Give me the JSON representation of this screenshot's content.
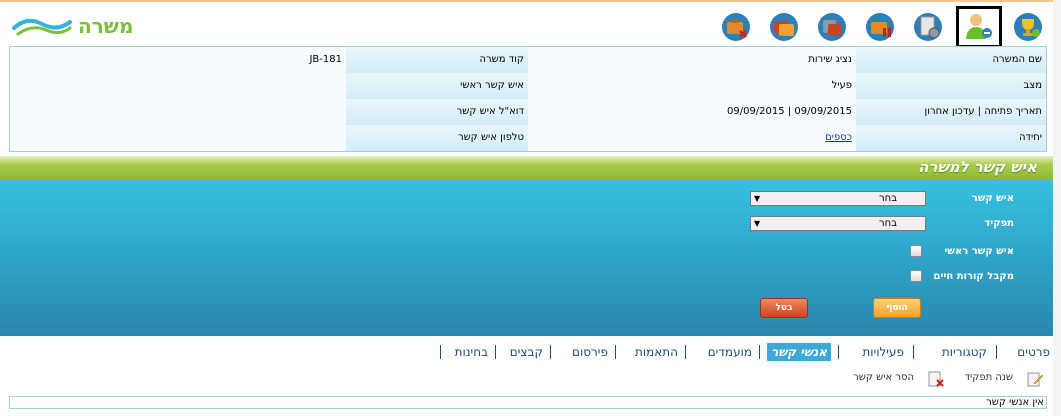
{
  "logo": {
    "text": "משרה"
  },
  "toolbar": {
    "icons": [
      {
        "name": "trophy-icon",
        "selected": false
      },
      {
        "name": "contact-person-icon",
        "selected": true
      },
      {
        "name": "document-settings-icon",
        "selected": false
      },
      {
        "name": "briefcase-pause-icon",
        "selected": false
      },
      {
        "name": "briefcase-copy-icon",
        "selected": false
      },
      {
        "name": "briefcase-stack-icon",
        "selected": false
      },
      {
        "name": "briefcase-delete-icon",
        "selected": false
      }
    ]
  },
  "info": {
    "rows": [
      {
        "label1": "שם המשרה",
        "value1": "נציג שירות",
        "label2": "קוד משרה",
        "value2": "JB-181"
      },
      {
        "label1": "מצב",
        "value1": "פעיל",
        "label2": "איש קשר ראשי",
        "value2": ""
      },
      {
        "label1": "תאריך פתיחה | עדכון אחרון",
        "value1": "09/09/2015 | 09/09/2015",
        "label2": "דוא\"ל איש קשר",
        "value2": ""
      },
      {
        "label1": "יחידה",
        "value1": "כספים",
        "label2": "טלפון איש קשר",
        "value2": ""
      }
    ]
  },
  "section": {
    "title": "איש קשר למשרה"
  },
  "form": {
    "contact_label": "איש קשר",
    "contact_value": "בחר",
    "role_label": "תפקיד",
    "role_value": "בחר",
    "primary_label": "איש קשר ראשי",
    "cv_label": "מקבל קורות חיים",
    "add_button": "הוסף",
    "cancel_button": "בטל"
  },
  "tabs": [
    {
      "label": "פרטים",
      "active": false
    },
    {
      "label": "קטגוריות",
      "active": false
    },
    {
      "label": "פעילויות",
      "active": false
    },
    {
      "label": "אנשי קשר",
      "active": true
    },
    {
      "label": "מועמדים",
      "active": false
    },
    {
      "label": "התאמות",
      "active": false
    },
    {
      "label": "פירסום",
      "active": false
    },
    {
      "label": "קבצים",
      "active": false
    },
    {
      "label": "בחינות",
      "active": false
    }
  ],
  "actions": {
    "change_role": "שנה תפקיד",
    "remove_contact": "הסר איש קשר"
  },
  "list": {
    "empty_message": "אין אנשי קשר"
  },
  "colors": {
    "accent_green": "#8cb832",
    "panel_blue": "#2fa7cc",
    "tab_active": "#3aa8d8",
    "logo_green": "#7cbf3a"
  }
}
